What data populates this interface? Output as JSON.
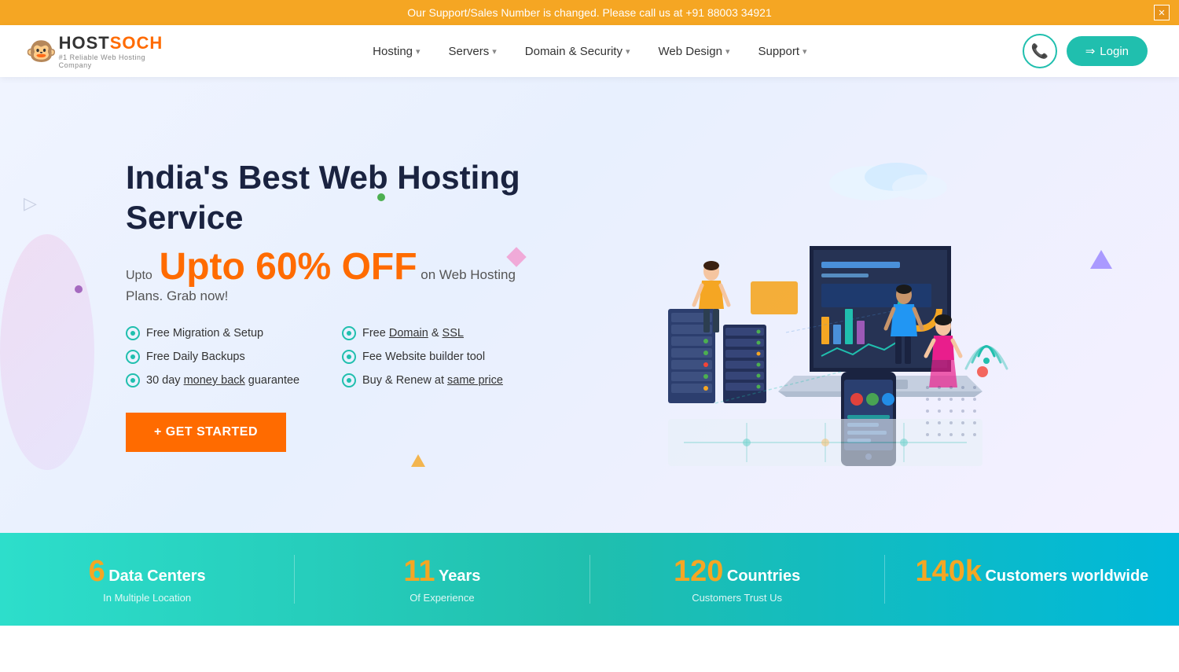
{
  "banner": {
    "text": "Our Support/Sales Number is changed. Please call us at +91 88003 34921",
    "close_label": "✕"
  },
  "header": {
    "logo_text_main": "HOSTSOCH",
    "logo_sub": "#1 Reliable Web Hosting Company",
    "nav_items": [
      {
        "label": "Hosting",
        "has_dropdown": true
      },
      {
        "label": "Servers",
        "has_dropdown": true
      },
      {
        "label": "Domain & Security",
        "has_dropdown": true
      },
      {
        "label": "Web Design",
        "has_dropdown": true
      },
      {
        "label": "Support",
        "has_dropdown": true
      }
    ],
    "phone_icon": "📞",
    "login_icon": "→",
    "login_label": "Login"
  },
  "hero": {
    "title": "India's Best Web Hosting Service",
    "subtitle_prefix": "Upto",
    "subtitle_big": "Upto 60% OFF",
    "subtitle_suffix": "on Web Hosting Plans. Grab now!",
    "features": [
      {
        "text": "Free Migration & Setup"
      },
      {
        "text": "Free Domain & SSL"
      },
      {
        "text": "Free Daily Backups"
      },
      {
        "text": "Fee Website builder tool"
      },
      {
        "text": "30 day money back guarantee"
      },
      {
        "text": "Buy & Renew at same price"
      }
    ],
    "cta_label": "+  GET STARTED"
  },
  "stats": [
    {
      "number": "6",
      "unit": "",
      "label_main": "Data Centers",
      "label_sub": "In Multiple Location"
    },
    {
      "number": "11",
      "unit": "",
      "label_main": "Years",
      "label_sub": "Of Experience"
    },
    {
      "number": "120",
      "unit": "",
      "label_main": "Countries",
      "label_sub": "Customers Trust Us"
    },
    {
      "number": "140",
      "unit": "k",
      "label_main": "Customers worldwide",
      "label_sub": ""
    }
  ],
  "colors": {
    "accent_orange": "#ff6b00",
    "accent_teal": "#20bfae",
    "accent_yellow": "#f5a623",
    "dark_blue": "#1a2340"
  }
}
